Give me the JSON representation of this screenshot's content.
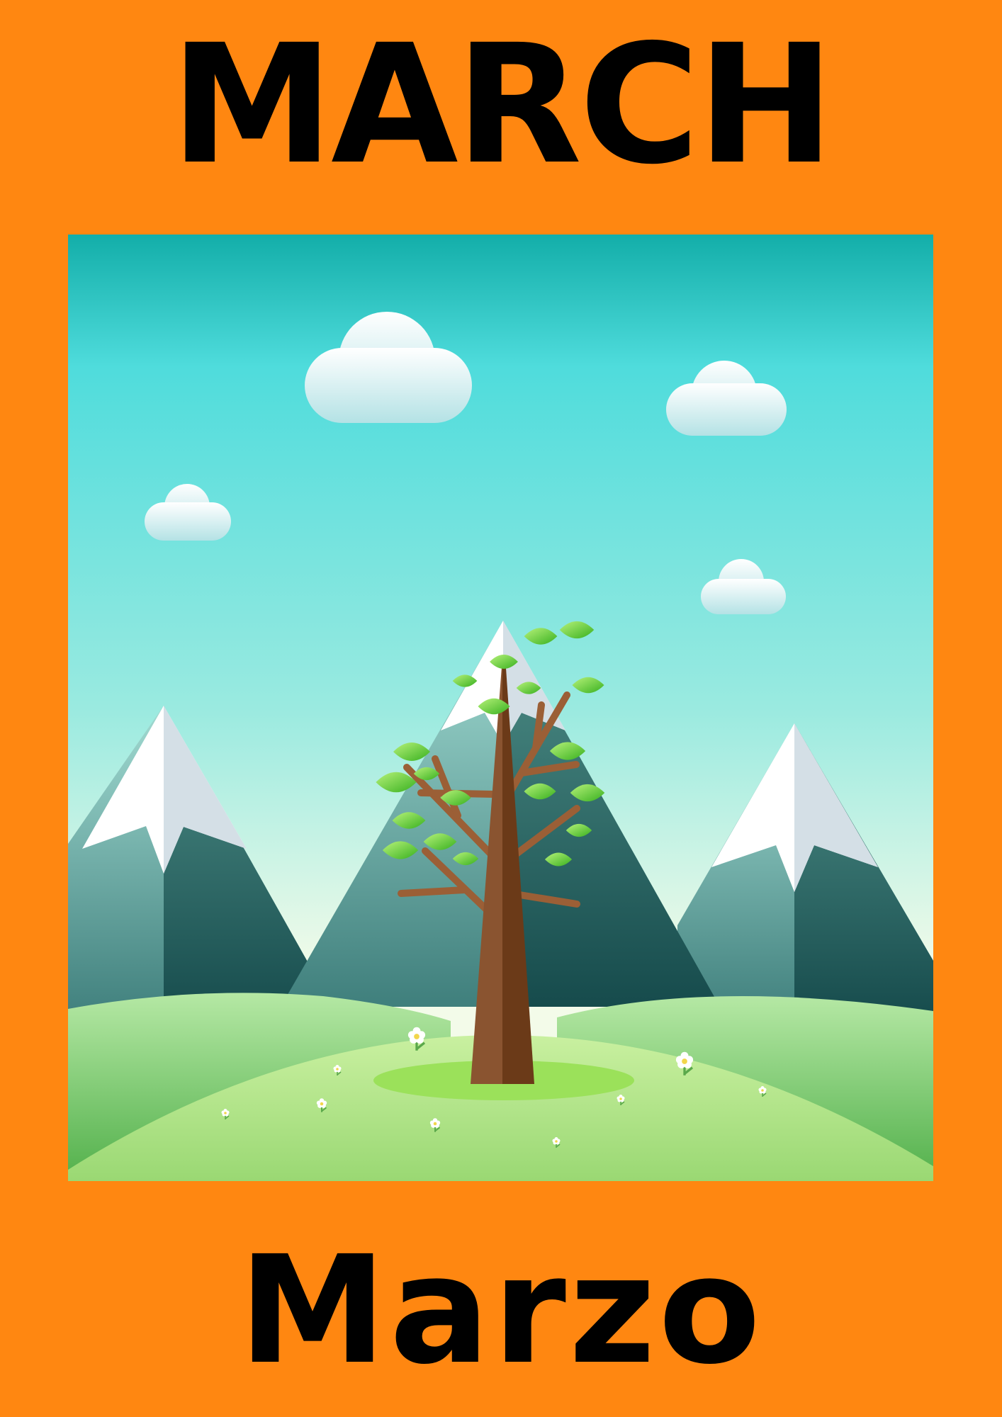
{
  "card": {
    "title_english": "MARCH",
    "title_spanish": "Marzo",
    "background_color": "#ff8711"
  },
  "illustration": {
    "icon": "spring-tree-mountain-landscape-icon",
    "sky_colors": [
      "#13aea9",
      "#4fdcdc",
      "#f3fbe9"
    ],
    "hill_color": "#8fd87a",
    "leaf_color": "#5ccd2b",
    "trunk_color": "#7a4422"
  }
}
